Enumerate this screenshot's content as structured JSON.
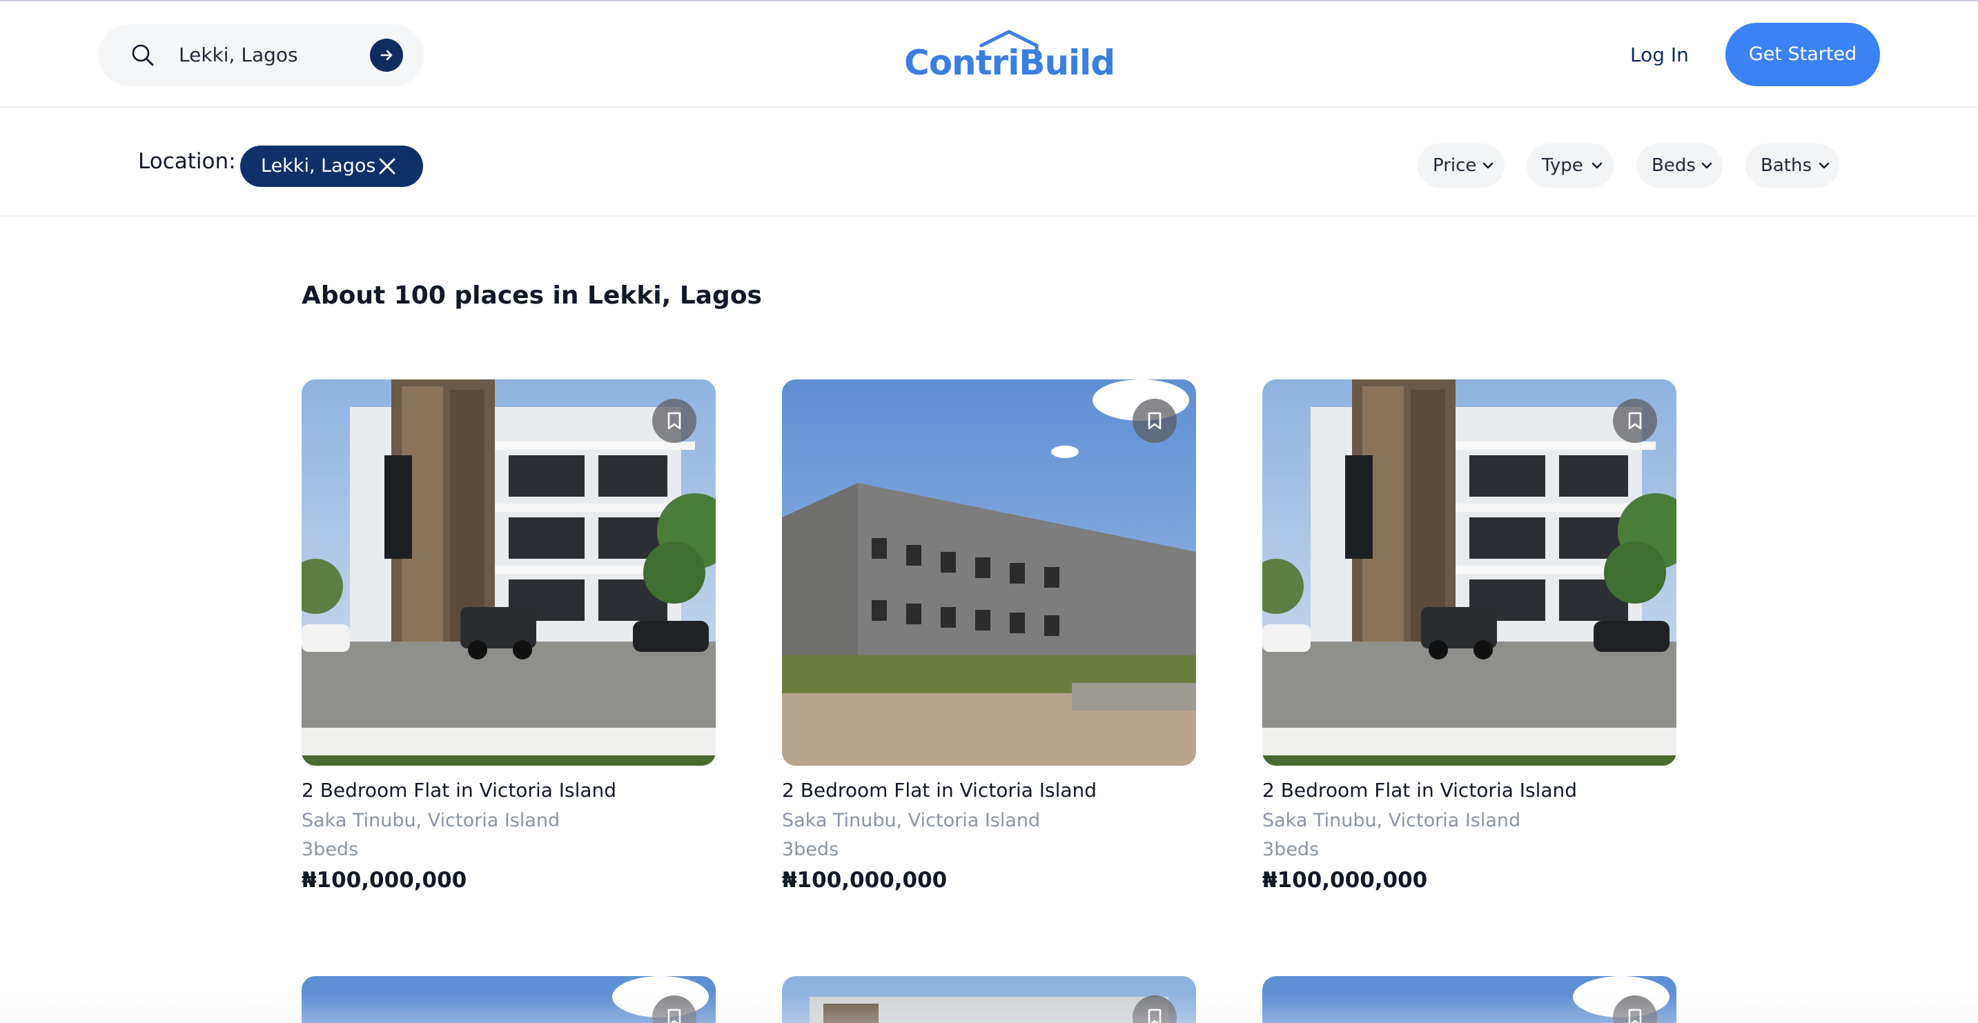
{
  "header": {
    "search": {
      "value": "Lekki, Lagos"
    },
    "logo": {
      "text": "ContriBuild"
    },
    "login_label": "Log In",
    "get_started_label": "Get Started"
  },
  "filters": {
    "location_label": "Location:",
    "location_chip": "Lekki, Lagos",
    "dropdowns": [
      "Price",
      "Type",
      "Beds",
      "Baths"
    ]
  },
  "results": {
    "title": "About 100 places in Lekki, Lagos",
    "listings": [
      {
        "title": "2 Bedroom Flat in Victoria Island",
        "location": "Saka Tinubu, Victoria Island",
        "beds": "3beds",
        "price": "₦100,000,000",
        "image": "modern-building-photo"
      },
      {
        "title": "2 Bedroom Flat in Victoria Island",
        "location": "Saka Tinubu, Victoria Island",
        "beds": "3beds",
        "price": "₦100,000,000",
        "image": "unfinished-building-photo"
      },
      {
        "title": "2 Bedroom Flat in Victoria Island",
        "location": "Saka Tinubu, Victoria Island",
        "beds": "3beds",
        "price": "₦100,000,000",
        "image": "modern-building-photo"
      }
    ]
  },
  "colors": {
    "brand_blue": "#3b82f6",
    "navy": "#10306a",
    "muted_text": "#8a94a6"
  }
}
